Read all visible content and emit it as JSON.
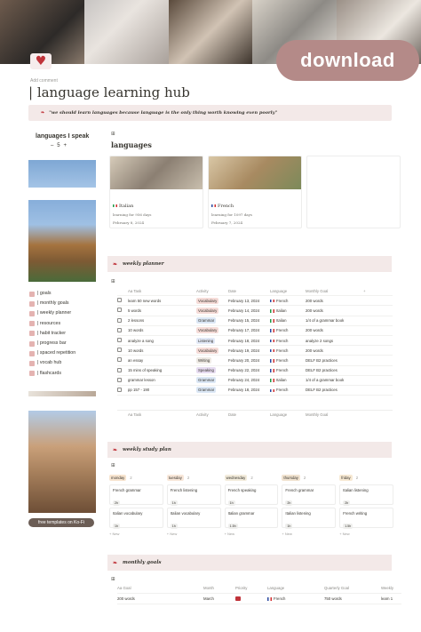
{
  "download_label": "download",
  "add_comment": "Add comment",
  "title": "| language learning hub",
  "quote": "\"we should learn languages because language is the only thing worth knowing even poorly\"",
  "lang_speak": {
    "label": "languages I speak",
    "value": "5",
    "minus": "–",
    "plus": "+"
  },
  "nav": [
    {
      "label": "| goals",
      "icon": "target-icon"
    },
    {
      "label": "| monthly goals",
      "icon": "calendar-icon"
    },
    {
      "label": "| weekly planner",
      "icon": "checklist-icon"
    },
    {
      "label": "| resources",
      "icon": "book-icon"
    },
    {
      "label": "| habit tracker",
      "icon": "habit-icon"
    },
    {
      "label": "| progress bar",
      "icon": "progress-icon"
    },
    {
      "label": "| spaced repetition",
      "icon": "repeat-icon"
    },
    {
      "label": "| vocab hub",
      "icon": "vocab-icon"
    },
    {
      "label": "| flashcards",
      "icon": "cards-icon"
    }
  ],
  "kofi": "free templates on Ko-Fi",
  "languages": {
    "heading": "languages",
    "cards": [
      {
        "name": "Italian",
        "streak": "learning for 956 days",
        "date": "February 8, 2024"
      },
      {
        "name": "French",
        "streak": "learning for 1097 days",
        "date": "February 7, 2024"
      }
    ]
  },
  "weekly_planner": {
    "heading": "weekly planner",
    "columns": {
      "task": "Aa Task",
      "activity": "Activity",
      "date": "Date",
      "language": "Language",
      "goal": "Monthly Goal",
      "plus": "+"
    },
    "rows": [
      {
        "task": "learn 50 new words",
        "activity": "Vocabulary",
        "date": "February 13, 2024",
        "language": "French",
        "goal": "200 words"
      },
      {
        "task": "5 words",
        "activity": "Vocabulary",
        "date": "February 14, 2024",
        "language": "Italian",
        "goal": "200 words"
      },
      {
        "task": "2 lessons",
        "activity": "Grammar",
        "date": "February 15, 2024",
        "language": "Italian",
        "goal": "1/4 of a grammar book"
      },
      {
        "task": "10 words",
        "activity": "Vocabulary",
        "date": "February 17, 2024",
        "language": "French",
        "goal": "200 words"
      },
      {
        "task": "analyze a song",
        "activity": "Listening",
        "date": "February 18, 2024",
        "language": "French",
        "goal": "analyze 2 songs"
      },
      {
        "task": "10 words",
        "activity": "Vocabulary",
        "date": "February 19, 2024",
        "language": "French",
        "goal": "200 words"
      },
      {
        "task": "an essay",
        "activity": "Writing",
        "date": "February 20, 2024",
        "language": "French",
        "goal": "DELF B2 practices"
      },
      {
        "task": "15 mins of speaking",
        "activity": "Speaking",
        "date": "February 22, 2024",
        "language": "French",
        "goal": "DELF B2 practices"
      },
      {
        "task": "grammar lesson",
        "activity": "Grammar",
        "date": "February 24, 2024",
        "language": "Italian",
        "goal": "1/4 of a grammar book"
      },
      {
        "task": "pp 157 - 190",
        "activity": "Grammar",
        "date": "February 18, 2024",
        "language": "French",
        "goal": "DELF B2 practices"
      }
    ],
    "footer": {
      "task": "Aa Task",
      "activity": "Activity",
      "date": "Date",
      "language": "Language",
      "goal": "Monthly Goal"
    }
  },
  "weekly_study": {
    "heading": "weekly study plan",
    "new_label": "+ New",
    "columns": [
      {
        "day": "monday",
        "count": "2",
        "cards": [
          {
            "title": "French grammar",
            "hours": "2h"
          },
          {
            "title": "Italian vocabulary",
            "hours": "1h"
          }
        ]
      },
      {
        "day": "tuesday",
        "count": "2",
        "cards": [
          {
            "title": "French listening",
            "hours": "1h"
          },
          {
            "title": "Italian vocabulary",
            "hours": "1h"
          }
        ]
      },
      {
        "day": "wednesday",
        "count": "2",
        "cards": [
          {
            "title": "French speaking",
            "hours": "1h"
          },
          {
            "title": "Italian grammar",
            "hours": "1.5h"
          }
        ]
      },
      {
        "day": "thursday",
        "count": "2",
        "cards": [
          {
            "title": "French grammar",
            "hours": "2h"
          },
          {
            "title": "Italian listening",
            "hours": "1h"
          }
        ]
      },
      {
        "day": "friday",
        "count": "2",
        "cards": [
          {
            "title": "Italian listening",
            "hours": "2h"
          },
          {
            "title": "French writing",
            "hours": "1.5h"
          }
        ]
      }
    ]
  },
  "monthly_goals": {
    "heading": "monthly goals",
    "columns": {
      "goal": "Aa Goal",
      "month": "Month",
      "priority": "Priority",
      "language": "Language",
      "quarterly": "Quarterly Goal",
      "weekly": "Weekly"
    },
    "rows": [
      {
        "goal": "200 words",
        "month": "March",
        "language": "French",
        "quarterly": "750 words",
        "weekly": "learn 1"
      }
    ]
  },
  "colors": {
    "accent": "#c0333a",
    "band": "#f3e9e8",
    "download": "#b48a88"
  }
}
